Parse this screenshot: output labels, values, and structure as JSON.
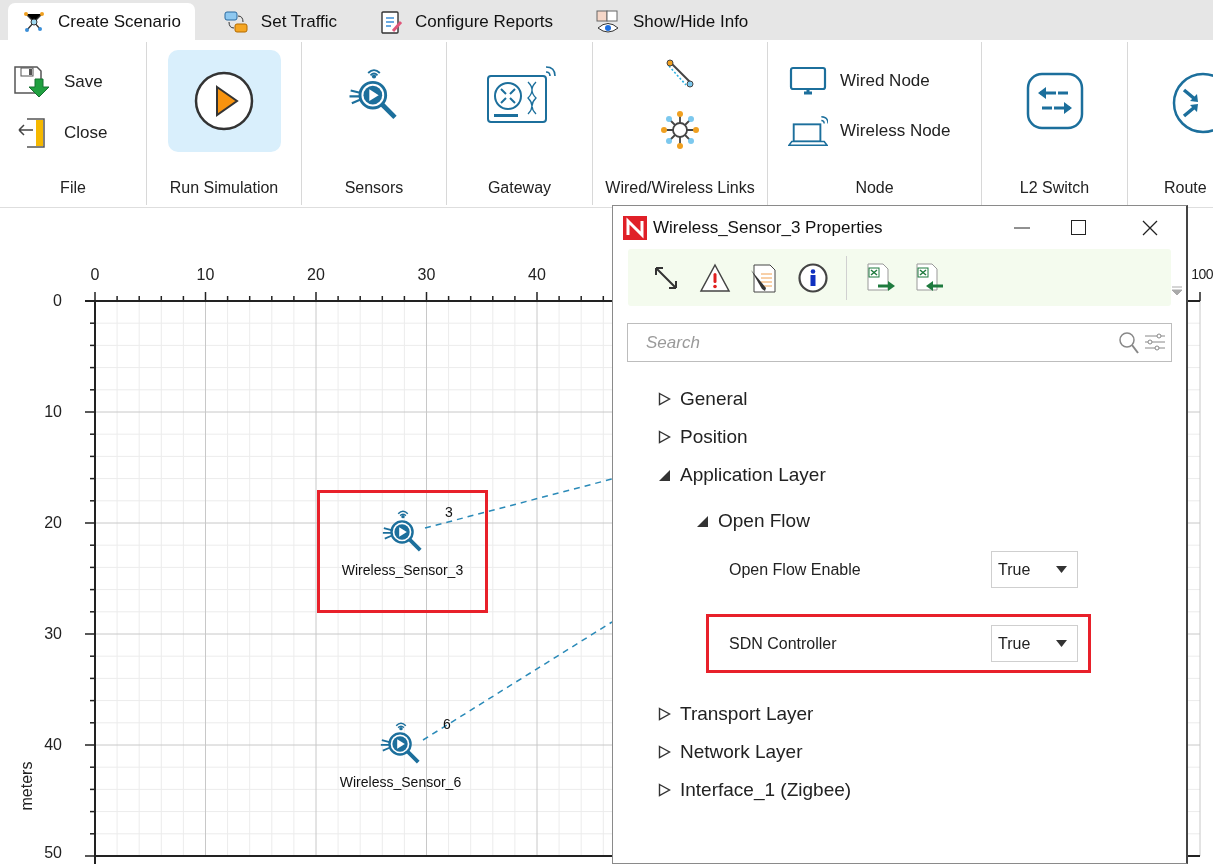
{
  "tabs": [
    {
      "label": "Create Scenario",
      "selected": true,
      "kind": "scenario"
    },
    {
      "label": "Set Traffic",
      "selected": false,
      "kind": "traffic"
    },
    {
      "label": "Configure Reports",
      "selected": false,
      "kind": "reports"
    },
    {
      "label": "Show/Hide Info",
      "selected": false,
      "kind": "info"
    }
  ],
  "ribbon": [
    {
      "kind": "file",
      "label": "File",
      "items": [
        {
          "kind": "save",
          "label": "Save"
        },
        {
          "kind": "close",
          "label": "Close"
        }
      ]
    },
    {
      "kind": "run",
      "label": "Run Simulation",
      "selected": true
    },
    {
      "kind": "sensors",
      "label": "Sensors"
    },
    {
      "kind": "gateway",
      "label": "Gateway"
    },
    {
      "kind": "links",
      "label": "Wired/Wireless Links"
    },
    {
      "kind": "node",
      "label": "Node",
      "items": [
        {
          "kind": "wired",
          "label": "Wired Node"
        },
        {
          "kind": "wireless",
          "label": "Wireless Node"
        }
      ]
    },
    {
      "kind": "switch",
      "label": "L2 Switch"
    },
    {
      "kind": "router",
      "label": "Route"
    }
  ],
  "canvas": {
    "x_ticks": [
      "0",
      "10",
      "20",
      "30",
      "40",
      "100"
    ],
    "y_ticks": [
      "0",
      "10",
      "20",
      "30",
      "40",
      "50"
    ],
    "y_label": "meters",
    "nodes": [
      {
        "name": "Wireless_Sensor_3",
        "link_label": "3",
        "highlighted": true
      },
      {
        "name": "Wireless_Sensor_6",
        "link_label": "6",
        "highlighted": false
      }
    ]
  },
  "dialog": {
    "title": "Wireless_Sensor_3 Properties",
    "search": {
      "placeholder": "Search"
    },
    "tree": [
      {
        "kind": "group",
        "label": "General",
        "expanded": false
      },
      {
        "kind": "group",
        "label": "Position",
        "expanded": false
      },
      {
        "kind": "group",
        "label": "Application Layer",
        "expanded": true,
        "children": [
          {
            "kind": "group",
            "label": "Open Flow",
            "expanded": true,
            "children": [
              {
                "kind": "property",
                "label": "Open Flow Enable",
                "value": "True",
                "highlighted": false
              },
              {
                "kind": "property",
                "label": "SDN Controller",
                "value": "True",
                "highlighted": true
              }
            ]
          }
        ]
      },
      {
        "kind": "group",
        "label": "Transport Layer",
        "expanded": false
      },
      {
        "kind": "group",
        "label": "Network Layer",
        "expanded": false
      },
      {
        "kind": "group",
        "label": "Interface_1 (Zigbee)",
        "expanded": false
      }
    ]
  }
}
